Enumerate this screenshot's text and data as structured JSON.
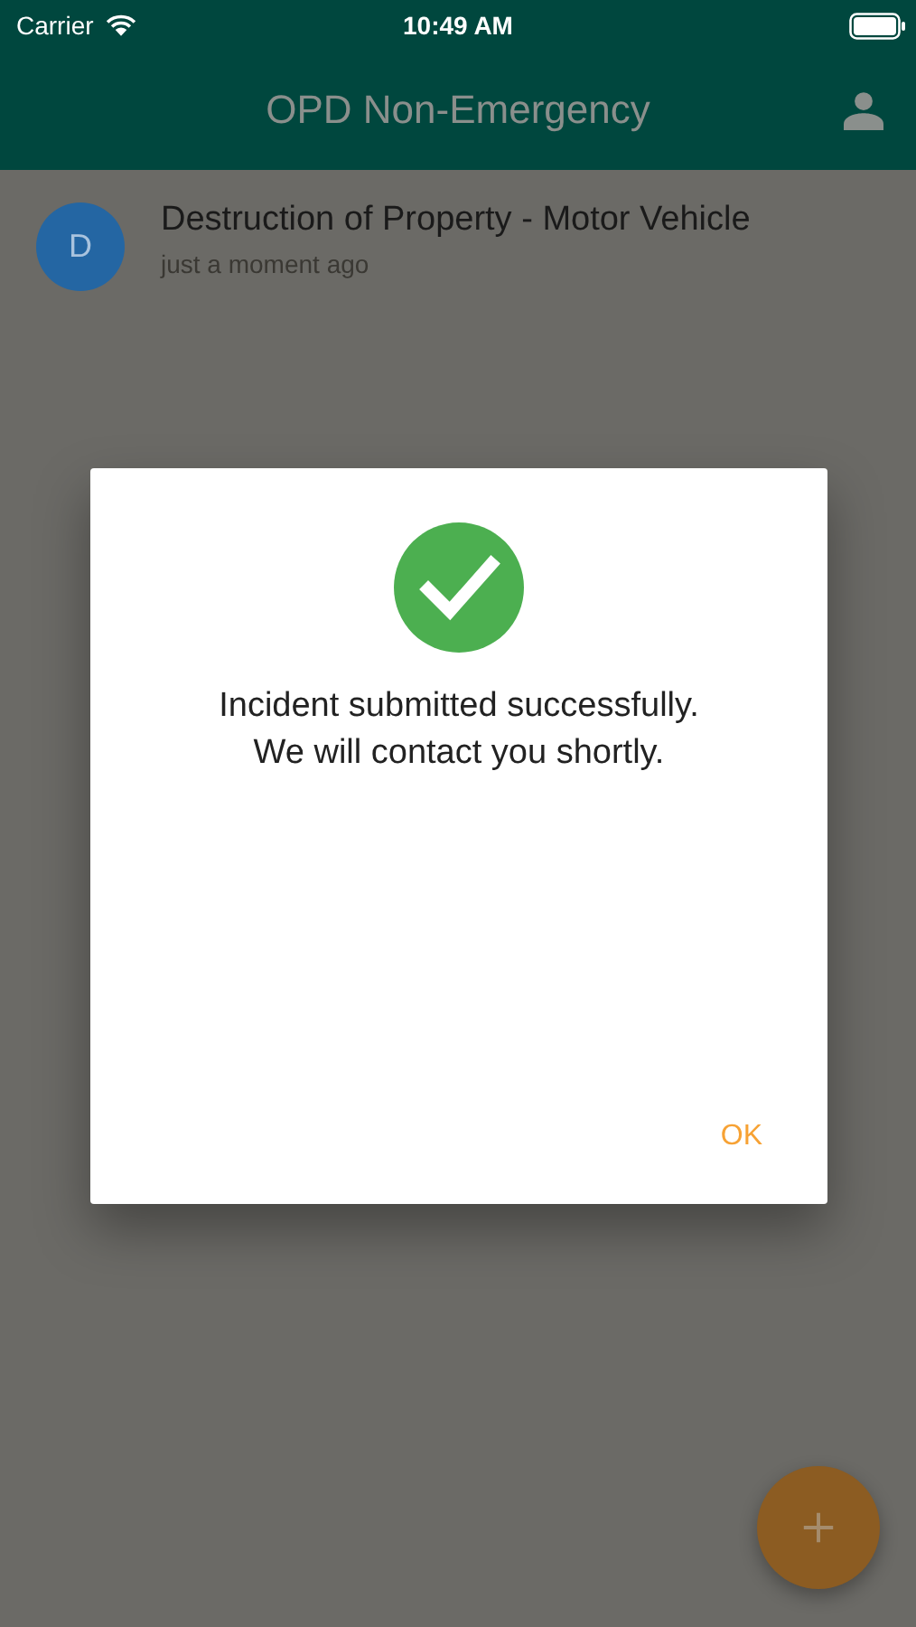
{
  "status_bar": {
    "carrier": "Carrier",
    "time": "10:49 AM"
  },
  "app_bar": {
    "title": "OPD Non-Emergency"
  },
  "incidents": [
    {
      "avatar": "D",
      "title": "Destruction of Property - Motor Vehicle",
      "time": "just a moment ago"
    }
  ],
  "dialog": {
    "message_lines": [
      "Incident submitted successfully.",
      "We will contact you shortly."
    ],
    "button": "OK"
  }
}
